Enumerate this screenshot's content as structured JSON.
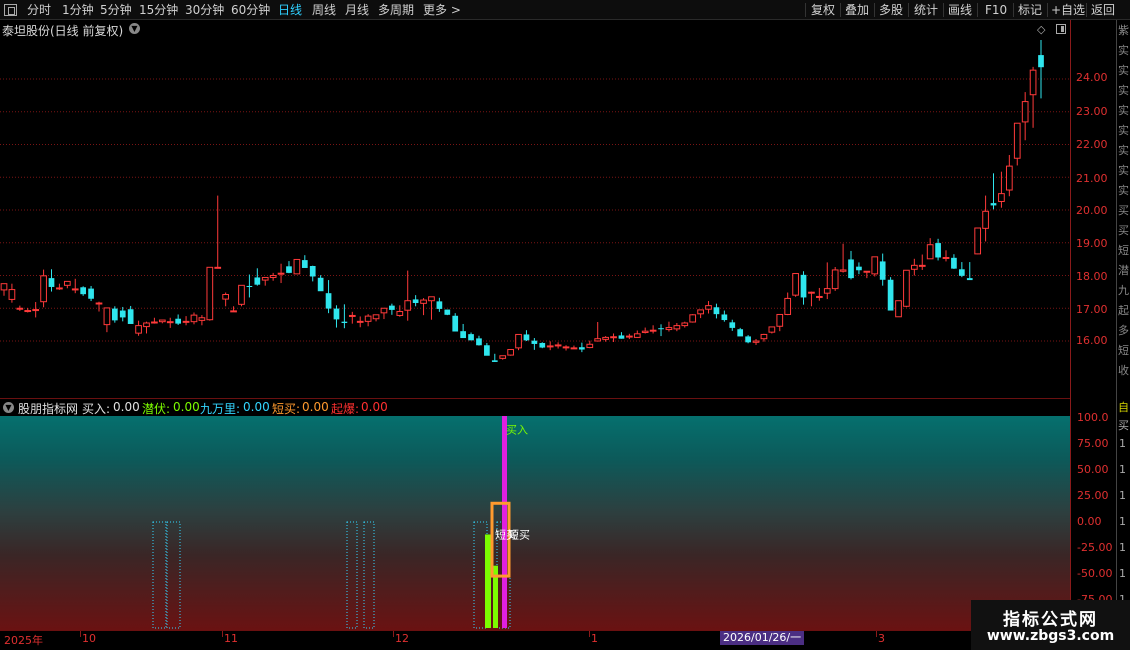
{
  "toolbar": {
    "left_items": [
      "分时",
      "1分钟",
      "5分钟",
      "15分钟",
      "30分钟",
      "60分钟",
      "日线",
      "周线",
      "月线",
      "多周期",
      "更多 >"
    ],
    "active": "日线",
    "right_items": [
      "复权",
      "叠加",
      "多股",
      "统计",
      "画线",
      "F10",
      "标记",
      "+自选",
      "返回"
    ]
  },
  "main_chart": {
    "title": "泰坦股份(日线 前复权)",
    "price_ticks": [
      "24.00",
      "23.00",
      "22.00",
      "21.00",
      "20.00",
      "19.00",
      "18.00",
      "17.00",
      "16.00"
    ],
    "right_strip_text": [
      "紫",
      "实",
      "实",
      "实",
      "实",
      "实",
      "实",
      "实",
      "实",
      "买",
      "买",
      "短",
      "潜",
      "九",
      "起",
      "多",
      "短",
      "收"
    ]
  },
  "indicator": {
    "name": "股朋指标网",
    "readouts": [
      {
        "label": "买入:",
        "value": "0.00",
        "color": "#e0e0e0"
      },
      {
        "label": "潜伏:",
        "value": "0.00",
        "color": "#7CFC00"
      },
      {
        "label": "九万里:",
        "value": "0.00",
        "color": "#33d6ff"
      },
      {
        "label": "短买:",
        "value": "0.00",
        "color": "#ff9a2e"
      },
      {
        "label": "起爆:",
        "value": "0.00",
        "color": "#ff3030"
      }
    ],
    "ticks": [
      "100.0",
      "75.00",
      "50.00",
      "25.00",
      "0.00",
      "-25.00",
      "-50.00",
      "-75.00"
    ],
    "annotations": {
      "buy": "买入",
      "short_buy": "短买"
    },
    "right_strip_text": [
      "自",
      "买",
      "1",
      "1",
      "1",
      "1",
      "1",
      "1",
      "1",
      "1",
      "1",
      "1"
    ]
  },
  "date_axis": {
    "labels": [
      "2025年",
      "10",
      "11",
      "12",
      "1",
      "3"
    ],
    "cursor": "2026/01/26/一"
  },
  "watermark": {
    "title": "指标公式网",
    "url": "www.zbgs3.com"
  },
  "colors": {
    "up": "#ff3a3a",
    "down": "#2fe6ee",
    "grid": "#7a1414",
    "axis_text": "#e03030"
  },
  "chart_data": {
    "type": "candlestick",
    "y_range": [
      15.2,
      25.0
    ],
    "candles": [
      [
        17.56,
        17.75,
        17.38,
        17.75
      ],
      [
        17.27,
        17.75,
        17.17,
        17.57
      ],
      [
        17.0,
        17.08,
        16.92,
        17.0
      ],
      [
        16.93,
        17.01,
        16.87,
        16.93
      ],
      [
        16.96,
        17.19,
        16.72,
        16.96
      ],
      [
        17.2,
        18.18,
        17.03,
        17.99
      ],
      [
        17.92,
        18.19,
        17.51,
        17.65
      ],
      [
        17.61,
        17.75,
        17.56,
        17.62
      ],
      [
        17.7,
        17.82,
        17.61,
        17.82
      ],
      [
        17.59,
        17.9,
        17.46,
        17.59
      ],
      [
        17.64,
        17.67,
        17.38,
        17.43
      ],
      [
        17.6,
        17.68,
        17.22,
        17.29
      ],
      [
        17.16,
        17.2,
        16.9,
        17.16
      ],
      [
        16.5,
        17.01,
        16.27,
        17.01
      ],
      [
        16.99,
        17.06,
        16.56,
        16.63
      ],
      [
        16.93,
        17.04,
        16.6,
        16.72
      ],
      [
        16.97,
        17.07,
        16.54,
        16.52
      ],
      [
        16.24,
        16.62,
        16.16,
        16.47
      ],
      [
        16.44,
        16.59,
        16.23,
        16.55
      ],
      [
        16.58,
        16.71,
        16.53,
        16.58
      ],
      [
        16.59,
        16.64,
        16.54,
        16.64
      ],
      [
        16.59,
        16.71,
        16.4,
        16.59
      ],
      [
        16.68,
        16.81,
        16.49,
        16.53
      ],
      [
        16.6,
        16.76,
        16.48,
        16.6
      ],
      [
        16.59,
        16.87,
        16.51,
        16.79
      ],
      [
        16.63,
        16.79,
        16.48,
        16.71
      ],
      [
        16.65,
        18.25,
        16.62,
        18.25
      ],
      [
        18.25,
        20.44,
        18.25,
        18.25
      ],
      [
        17.28,
        17.48,
        17.06,
        17.42
      ],
      [
        16.92,
        17.06,
        16.89,
        16.92
      ],
      [
        17.12,
        17.7,
        17.06,
        17.7
      ],
      [
        17.68,
        18.03,
        17.33,
        17.67
      ],
      [
        17.94,
        18.22,
        17.69,
        17.72
      ],
      [
        17.86,
        17.95,
        17.69,
        17.94
      ],
      [
        17.94,
        18.08,
        17.84,
        18.0
      ],
      [
        18.07,
        18.36,
        17.77,
        18.07
      ],
      [
        18.28,
        18.44,
        18.07,
        18.08
      ],
      [
        18.05,
        18.47,
        18.05,
        18.49
      ],
      [
        18.47,
        18.62,
        18.35,
        18.23
      ],
      [
        18.29,
        18.3,
        17.82,
        17.97
      ],
      [
        17.93,
        18.01,
        17.62,
        17.52
      ],
      [
        17.46,
        17.86,
        16.85,
        16.99
      ],
      [
        16.99,
        17.09,
        16.41,
        16.66
      ],
      [
        16.59,
        17.12,
        16.39,
        16.55
      ],
      [
        16.78,
        16.89,
        16.53,
        16.78
      ],
      [
        16.6,
        16.75,
        16.42,
        16.6
      ],
      [
        16.6,
        16.82,
        16.45,
        16.76
      ],
      [
        16.68,
        16.71,
        16.6,
        16.8
      ],
      [
        16.86,
        16.99,
        16.67,
        17.0
      ],
      [
        17.08,
        17.14,
        16.8,
        16.95
      ],
      [
        16.78,
        17.09,
        16.74,
        16.9
      ],
      [
        16.94,
        18.15,
        16.62,
        17.23
      ],
      [
        17.27,
        17.4,
        17.06,
        17.16
      ],
      [
        17.15,
        17.31,
        16.79,
        17.25
      ],
      [
        17.23,
        17.3,
        16.65,
        17.35
      ],
      [
        17.21,
        17.32,
        16.89,
        16.98
      ],
      [
        16.96,
        16.96,
        16.79,
        16.8
      ],
      [
        16.77,
        16.85,
        16.52,
        16.29
      ],
      [
        16.3,
        16.52,
        16.21,
        16.09
      ],
      [
        16.21,
        16.26,
        16.09,
        16.02
      ],
      [
        16.08,
        16.16,
        15.86,
        15.87
      ],
      [
        15.87,
        15.94,
        15.61,
        15.55
      ],
      [
        15.41,
        15.61,
        15.36,
        15.36
      ],
      [
        15.47,
        15.54,
        15.43,
        15.55
      ],
      [
        15.57,
        15.73,
        15.55,
        15.74
      ],
      [
        15.79,
        16.2,
        15.72,
        16.2
      ],
      [
        16.2,
        16.33,
        16.0,
        16.02
      ],
      [
        16.01,
        16.09,
        15.73,
        15.91
      ],
      [
        15.94,
        15.96,
        15.78,
        15.8
      ],
      [
        15.85,
        15.99,
        15.72,
        15.85
      ],
      [
        15.88,
        15.96,
        15.77,
        15.88
      ],
      [
        15.82,
        15.87,
        15.71,
        15.82
      ],
      [
        15.79,
        15.86,
        15.75,
        15.79
      ],
      [
        15.81,
        15.95,
        15.66,
        15.74
      ],
      [
        15.8,
        16.01,
        15.78,
        15.9
      ],
      [
        16.0,
        16.58,
        15.98,
        16.07
      ],
      [
        16.05,
        16.15,
        15.98,
        16.11
      ],
      [
        16.13,
        16.23,
        15.97,
        16.13
      ],
      [
        16.17,
        16.27,
        16.07,
        16.07
      ],
      [
        16.15,
        16.22,
        16.06,
        16.15
      ],
      [
        16.11,
        16.32,
        16.1,
        16.22
      ],
      [
        16.26,
        16.41,
        16.23,
        16.3
      ],
      [
        16.33,
        16.48,
        16.23,
        16.33
      ],
      [
        16.39,
        16.51,
        16.15,
        16.36
      ],
      [
        16.35,
        16.59,
        16.29,
        16.41
      ],
      [
        16.37,
        16.55,
        16.3,
        16.47
      ],
      [
        16.47,
        16.59,
        16.41,
        16.55
      ],
      [
        16.58,
        16.82,
        16.56,
        16.8
      ],
      [
        16.83,
        16.88,
        16.7,
        16.95
      ],
      [
        16.97,
        17.22,
        16.84,
        17.08
      ],
      [
        17.03,
        17.14,
        16.69,
        16.82
      ],
      [
        16.81,
        16.93,
        16.59,
        16.64
      ],
      [
        16.57,
        16.65,
        16.31,
        16.4
      ],
      [
        16.36,
        16.4,
        16.17,
        16.14
      ],
      [
        16.14,
        16.18,
        15.93,
        15.96
      ],
      [
        15.96,
        16.06,
        15.88,
        16.0
      ],
      [
        16.07,
        16.22,
        15.98,
        16.2
      ],
      [
        16.27,
        16.39,
        16.23,
        16.43
      ],
      [
        16.45,
        16.81,
        16.3,
        16.81
      ],
      [
        16.81,
        17.48,
        16.79,
        17.3
      ],
      [
        17.4,
        18.04,
        17.35,
        18.06
      ],
      [
        18.02,
        18.13,
        17.11,
        17.33
      ],
      [
        17.47,
        17.51,
        17.06,
        17.49
      ],
      [
        17.36,
        17.62,
        17.23,
        17.36
      ],
      [
        17.46,
        18.4,
        17.28,
        17.6
      ],
      [
        17.6,
        18.26,
        17.53,
        18.17
      ],
      [
        18.13,
        18.97,
        18.09,
        18.17
      ],
      [
        18.49,
        18.75,
        17.88,
        17.92
      ],
      [
        18.27,
        18.4,
        18.04,
        18.16
      ],
      [
        18.13,
        18.13,
        17.92,
        18.13
      ],
      [
        18.05,
        18.38,
        17.97,
        18.57
      ],
      [
        18.43,
        18.67,
        17.69,
        17.87
      ],
      [
        17.87,
        17.95,
        17.32,
        16.93
      ],
      [
        16.74,
        17.1,
        16.74,
        17.23
      ],
      [
        17.06,
        18.16,
        17.03,
        18.16
      ],
      [
        18.19,
        18.51,
        18.0,
        18.31
      ],
      [
        18.31,
        18.64,
        18.17,
        18.31
      ],
      [
        18.51,
        19.14,
        18.51,
        18.94
      ],
      [
        18.99,
        19.12,
        18.46,
        18.55
      ],
      [
        18.53,
        18.77,
        18.43,
        18.55
      ],
      [
        18.54,
        18.65,
        18.2,
        18.21
      ],
      [
        18.19,
        18.41,
        17.95,
        17.99
      ],
      [
        17.92,
        18.41,
        17.88,
        17.86
      ],
      [
        18.66,
        19.3,
        18.65,
        19.45
      ],
      [
        19.44,
        20.44,
        19.04,
        19.96
      ],
      [
        20.21,
        21.12,
        20.02,
        20.14
      ],
      [
        20.26,
        21.17,
        20.07,
        20.5
      ],
      [
        20.61,
        21.68,
        20.42,
        21.34
      ],
      [
        21.58,
        22.49,
        21.36,
        22.65
      ],
      [
        22.69,
        23.6,
        22.13,
        23.31
      ],
      [
        23.52,
        24.37,
        22.51,
        24.27
      ],
      [
        24.73,
        25.19,
        23.41,
        24.36
      ]
    ]
  }
}
